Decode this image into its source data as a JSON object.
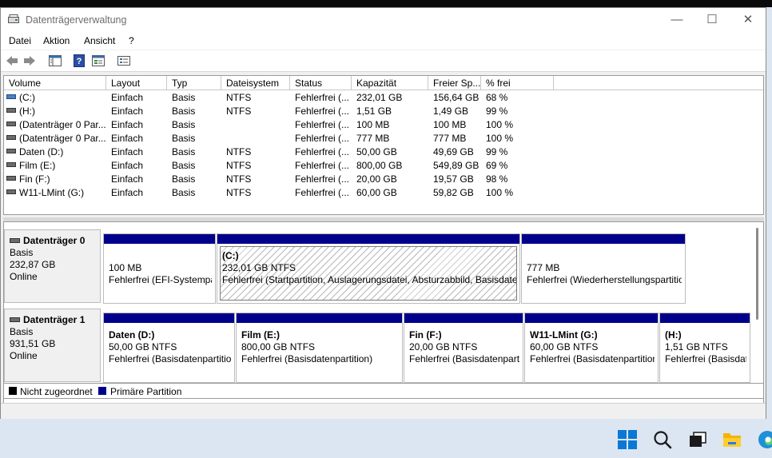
{
  "window": {
    "title": "Datenträgerverwaltung",
    "controls": {
      "minimize": "—",
      "maximize": "☐",
      "close": "✕"
    }
  },
  "menu": [
    "Datei",
    "Aktion",
    "Ansicht",
    "?"
  ],
  "toolbar": {
    "icons": [
      "back-arrow-icon",
      "forward-arrow-icon",
      "console-tree-icon",
      "help-icon",
      "properties-icon",
      "list-view-icon"
    ]
  },
  "volumes": {
    "headers": [
      "Volume",
      "Layout",
      "Typ",
      "Dateisystem",
      "Status",
      "Kapazität",
      "Freier Sp...",
      "% frei"
    ],
    "rows": [
      [
        "(C:)",
        "Einfach",
        "Basis",
        "NTFS",
        "Fehlerfrei (...",
        "232,01 GB",
        "156,64 GB",
        "68 %"
      ],
      [
        "(H:)",
        "Einfach",
        "Basis",
        "NTFS",
        "Fehlerfrei (...",
        "1,51 GB",
        "1,49 GB",
        "99 %"
      ],
      [
        "(Datenträger 0 Par...",
        "Einfach",
        "Basis",
        "",
        "Fehlerfrei (...",
        "100 MB",
        "100 MB",
        "100 %"
      ],
      [
        "(Datenträger 0 Par...",
        "Einfach",
        "Basis",
        "",
        "Fehlerfrei (...",
        "777 MB",
        "777 MB",
        "100 %"
      ],
      [
        "Daten (D:)",
        "Einfach",
        "Basis",
        "NTFS",
        "Fehlerfrei (...",
        "50,00 GB",
        "49,69 GB",
        "99 %"
      ],
      [
        "Film (E:)",
        "Einfach",
        "Basis",
        "NTFS",
        "Fehlerfrei (...",
        "800,00 GB",
        "549,89 GB",
        "69 %"
      ],
      [
        "Fin (F:)",
        "Einfach",
        "Basis",
        "NTFS",
        "Fehlerfrei (...",
        "20,00 GB",
        "19,57 GB",
        "98 %"
      ],
      [
        "W11-LMint (G:)",
        "Einfach",
        "Basis",
        "NTFS",
        "Fehlerfrei (...",
        "60,00 GB",
        "59,82 GB",
        "100 %"
      ]
    ]
  },
  "disks": [
    {
      "name": "Datenträger 0",
      "type": "Basis",
      "size": "232,87 GB",
      "state": "Online",
      "partitions": [
        {
          "name": "",
          "size": "100 MB",
          "status": "Fehlerfrei (EFI-Systempartition)"
        },
        {
          "name": "(C:)",
          "size": "232,01 GB NTFS",
          "status": "Fehlerfrei (Startpartition, Auslagerungsdatei, Absturzabbild, Basisdatenpartition)"
        },
        {
          "name": "",
          "size": "777 MB",
          "status": "Fehlerfrei (Wiederherstellungspartition)"
        }
      ]
    },
    {
      "name": "Datenträger 1",
      "type": "Basis",
      "size": "931,51 GB",
      "state": "Online",
      "partitions": [
        {
          "name": "Daten  (D:)",
          "size": "50,00 GB NTFS",
          "status": "Fehlerfrei (Basisdatenpartition)"
        },
        {
          "name": "Film  (E:)",
          "size": "800,00 GB NTFS",
          "status": "Fehlerfrei (Basisdatenpartition)"
        },
        {
          "name": "Fin  (F:)",
          "size": "20,00 GB NTFS",
          "status": "Fehlerfrei (Basisdatenpartition)"
        },
        {
          "name": "W11-LMint  (G:)",
          "size": "60,00 GB NTFS",
          "status": "Fehlerfrei (Basisdatenpartition)"
        },
        {
          "name": "(H:)",
          "size": "1,51 GB NTFS",
          "status": "Fehlerfrei (Basisdatenpartition)"
        }
      ]
    }
  ],
  "legend": [
    {
      "label": "Nicht zugeordnet",
      "color": "#000000"
    },
    {
      "label": "Primäre Partition",
      "color": "#00008b"
    }
  ],
  "taskbar": {
    "icons": [
      "windows-start-icon",
      "search-icon",
      "task-view-icon",
      "file-explorer-icon",
      "edge-icon"
    ]
  }
}
